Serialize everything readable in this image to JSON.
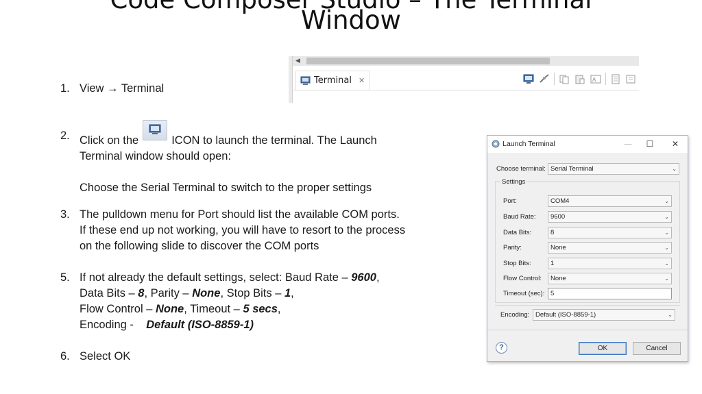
{
  "slide": {
    "title_line1": "Code Composer Studio – The Terminal",
    "title_line2": "Window"
  },
  "terminal_view": {
    "tab_label": "Terminal",
    "toolbar_icons": [
      "open-terminal-icon",
      "connect-icon",
      "copy-icon",
      "paste-icon",
      "select-all-icon",
      "clear-icon",
      "scroll-lock-icon"
    ]
  },
  "steps": [
    {
      "num": "1.",
      "line1": "View → Terminal"
    },
    {
      "num": "2.",
      "line1_pre": "Click on the",
      "line1_post": "ICON to launch the terminal.  The Launch",
      "line2": "Terminal window should open:",
      "line3": "Choose the Serial Terminal to switch to the proper settings"
    },
    {
      "num": "3.",
      "line1": "The pulldown menu for Port should list the available COM ports.",
      "line2": "If these end up not working, you will have to resort to the process",
      "line3": "on the following slide to discover the COM ports"
    },
    {
      "num": "5.",
      "l1a": "If not already the default settings, select:   Baud Rate – ",
      "l1b": "9600",
      "l1c": ",",
      "l2a": "Data Bits – ",
      "l2b": "8",
      "l2c": ",   Parity – ",
      "l2d": "None",
      "l2e": ",  Stop Bits – ",
      "l2f": "1",
      "l2g": ",",
      "l3a": "Flow Control – ",
      "l3b": "None",
      "l3c": ",  Timeout – ",
      "l3d": "5 secs",
      "l3e": ",",
      "l4a": "Encoding -    ",
      "l4b": "Default (ISO-8859-1)"
    },
    {
      "num": "6.",
      "line1": "Select OK"
    }
  ],
  "dialog": {
    "title": "Launch Terminal",
    "choose_terminal_label": "Choose terminal:",
    "choose_terminal_value": "Serial Terminal",
    "settings_label": "Settings",
    "fields": [
      {
        "label": "Port:",
        "value": "COM4"
      },
      {
        "label": "Baud Rate:",
        "value": "9600"
      },
      {
        "label": "Data Bits:",
        "value": "8"
      },
      {
        "label": "Parity:",
        "value": "None"
      },
      {
        "label": "Stop Bits:",
        "value": "1"
      },
      {
        "label": "Flow Control:",
        "value": "None"
      }
    ],
    "timeout_label": "Timeout (sec):",
    "timeout_value": "5",
    "encoding_label": "Encoding:",
    "encoding_value": "Default (ISO-8859-1)",
    "ok_label": "OK",
    "cancel_label": "Cancel",
    "help_glyph": "?",
    "minimize_glyph": "—",
    "maximize_glyph": "☐",
    "close_glyph": "✕"
  }
}
